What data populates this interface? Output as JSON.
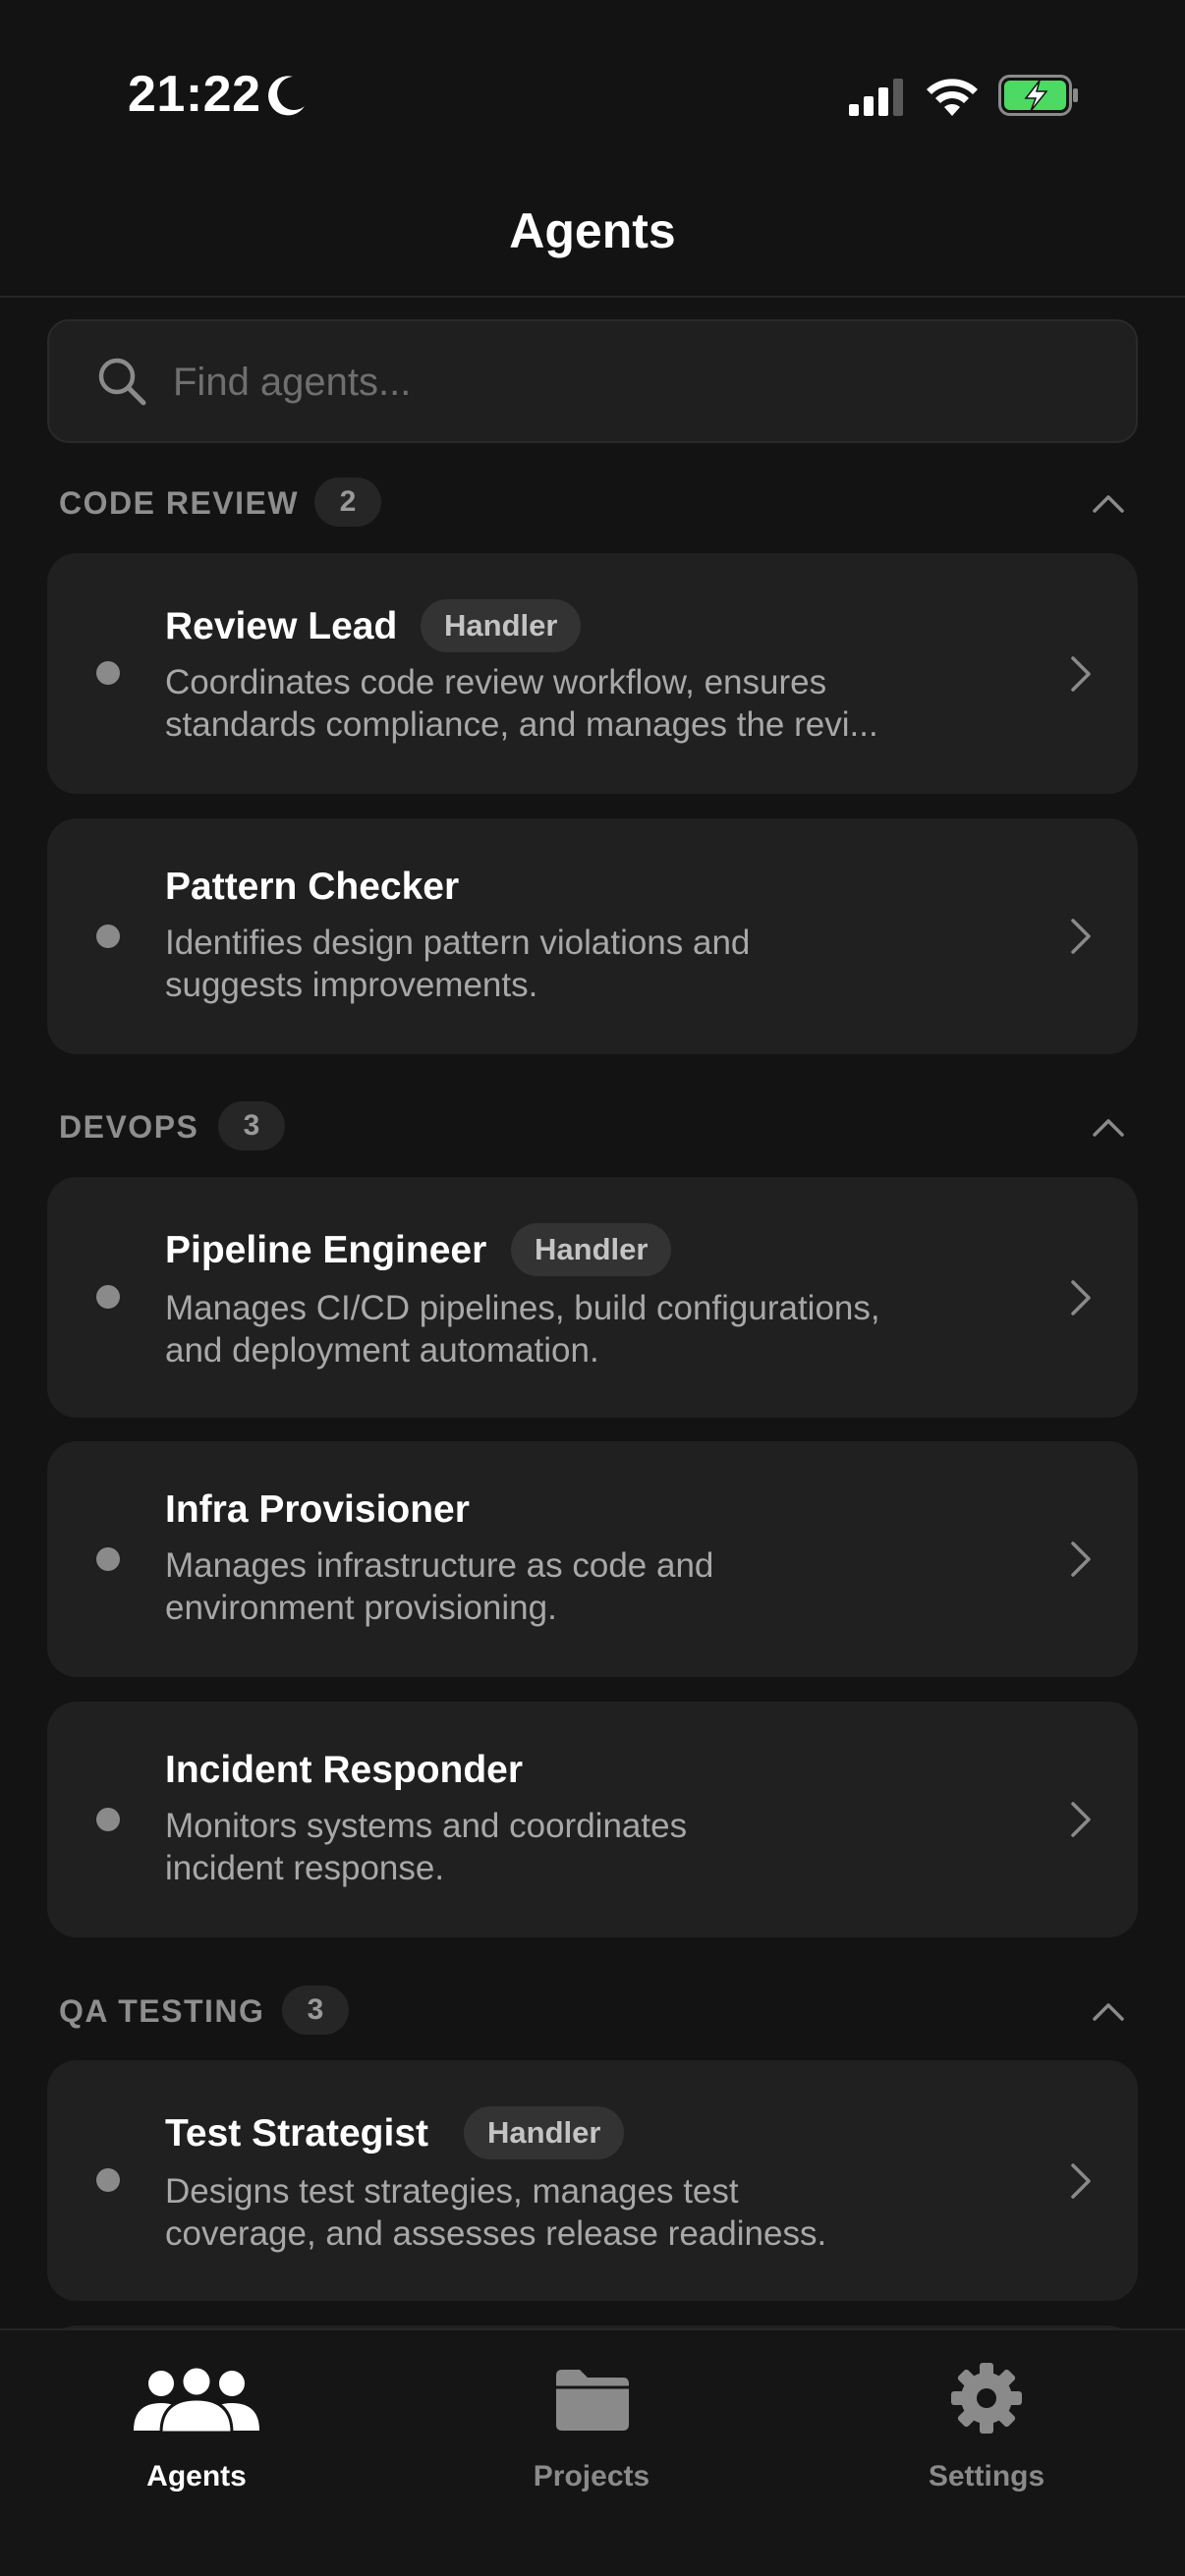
{
  "status_bar": {
    "time": "21:22"
  },
  "nav": {
    "title": "Agents"
  },
  "search": {
    "placeholder": "Find agents..."
  },
  "sections": [
    {
      "title": "CODE REVIEW",
      "count": "2",
      "agents": [
        {
          "name": "Review Lead",
          "badge": "Handler",
          "desc_line1": "Coordinates code review workflow, ensures",
          "desc_line2": "standards compliance, and manages the revi..."
        },
        {
          "name": "Pattern Checker",
          "desc_line1": "Identifies design pattern violations and",
          "desc_line2": "suggests improvements."
        }
      ]
    },
    {
      "title": "DEVOPS",
      "count": "3",
      "agents": [
        {
          "name": "Pipeline Engineer",
          "badge": "Handler",
          "desc_line1": "Manages CI/CD pipelines, build configurations,",
          "desc_line2": "and deployment automation."
        },
        {
          "name": "Infra Provisioner",
          "desc_line1": "Manages infrastructure as code and",
          "desc_line2": "environment provisioning."
        },
        {
          "name": "Incident Responder",
          "desc_line1": "Monitors systems and coordinates",
          "desc_line2": "incident response."
        }
      ]
    },
    {
      "title": "QA TESTING",
      "count": "3",
      "agents": [
        {
          "name": "Test Strategist",
          "badge": "Handler",
          "desc_line1": "Designs test strategies, manages test",
          "desc_line2": "coverage, and assesses release readiness."
        }
      ]
    }
  ],
  "tab_bar": {
    "tabs": [
      {
        "label": "Agents",
        "icon": "people-icon",
        "active": true
      },
      {
        "label": "Projects",
        "icon": "folder-icon",
        "active": false
      },
      {
        "label": "Settings",
        "icon": "gear-icon",
        "active": false
      }
    ]
  },
  "colors": {
    "background": "#131313",
    "card": "#202020",
    "battery_fill": "#4cd964",
    "active_tab": "#ffffff",
    "inactive_tab": "#8a8a8a"
  }
}
